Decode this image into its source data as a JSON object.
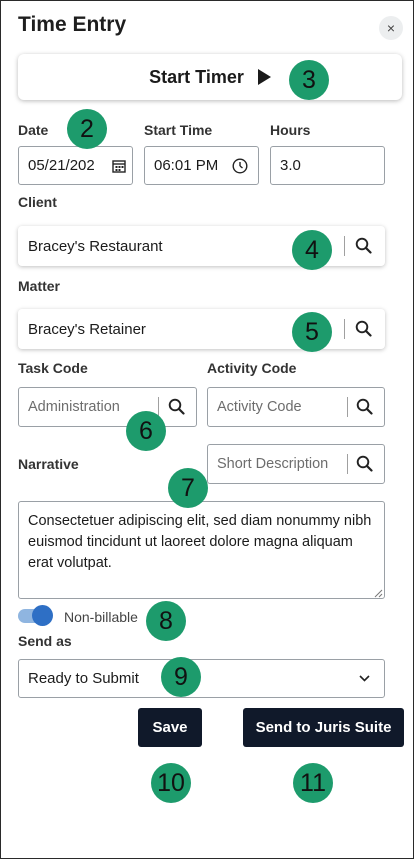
{
  "header": {
    "title": "Time Entry",
    "close_symbol": "×"
  },
  "timer": {
    "label": "Start Timer",
    "icon": "play-icon"
  },
  "date": {
    "label": "Date",
    "value": "05/21/202"
  },
  "start_time": {
    "label": "Start Time",
    "value": "06:01 PM"
  },
  "hours": {
    "label": "Hours",
    "value": "3.0"
  },
  "client": {
    "label": "Client",
    "value": "Bracey's Restaurant"
  },
  "matter": {
    "label": "Matter",
    "value": "Bracey's Retainer"
  },
  "task_code": {
    "label": "Task Code",
    "value": "Administration"
  },
  "activity_code": {
    "label": "Activity Code",
    "placeholder": "Activity Code"
  },
  "narrative": {
    "label": "Narrative",
    "short_description_placeholder": "Short Description",
    "text": "Consectetuer adipiscing elit, sed diam nonummy nibh euismod tincidunt ut laoreet dolore magna aliquam erat volutpat."
  },
  "billing": {
    "toggle_label": "Non-billable",
    "toggle_on": true
  },
  "send_as": {
    "label": "Send as",
    "selected": "Ready to Submit"
  },
  "actions": {
    "save": "Save",
    "send": "Send to Juris Suite"
  },
  "callouts": [
    "2",
    "3",
    "4",
    "5",
    "6",
    "7",
    "8",
    "9",
    "10",
    "11"
  ],
  "colors": {
    "callout": "#1d9b6c",
    "button_dark": "#10192a",
    "toggle": "#2e6fc5"
  }
}
